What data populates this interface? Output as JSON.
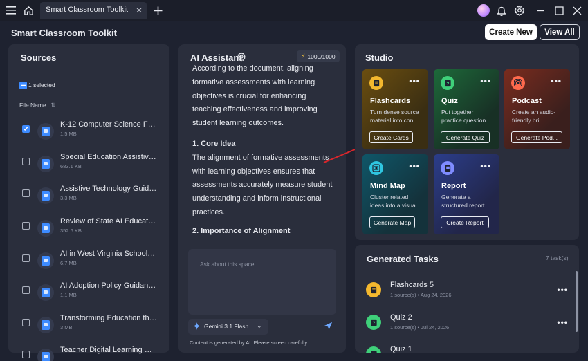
{
  "titlebar": {
    "tab_title": "Smart Classroom Toolkit"
  },
  "header": {
    "title": "Smart Classroom Toolkit",
    "create_new": "Create New",
    "view_all": "View All"
  },
  "sources": {
    "title": "Sources",
    "selected_text": "1 selected",
    "column_label": "File Name",
    "items": [
      {
        "title": "K-12 Computer Science For...",
        "size": "1.5 MB",
        "checked": true
      },
      {
        "title": "Special Education Assistive ...",
        "size": "683.1 KB",
        "checked": false
      },
      {
        "title": "Assistive Technology Guide...",
        "size": "3.3 MB",
        "checked": false
      },
      {
        "title": "Review of State AI Educatio...",
        "size": "352.6 KB",
        "checked": false
      },
      {
        "title": "AI in West Virginia Schools ...",
        "size": "6.7 MB",
        "checked": false
      },
      {
        "title": "AI Adoption Policy Guidanc...",
        "size": "1.1 MB",
        "checked": false
      },
      {
        "title": "Transforming Education thr...",
        "size": "3 MB",
        "checked": false
      },
      {
        "title": "Teacher Digital Learning Gui...",
        "size": "",
        "checked": false
      }
    ]
  },
  "assistant": {
    "title": "AI Assistant",
    "credits": "1000/1000",
    "para1": "According to the document, aligning formative assessments with learning objectives is crucial for enhancing teaching effectiveness and improving student learning outcomes.",
    "heading1": "1. Core Idea",
    "para2": "The alignment of formative assessments with learning objectives ensures that assessments accurately measure student understanding and inform instructional practices.",
    "heading2": "2. Importance of Alignment",
    "input_placeholder": "Ask about this space...",
    "model": "Gemini 3.1 Flash",
    "disclaimer": "Content is generated by AI. Please screen carefully."
  },
  "studio": {
    "title": "Studio",
    "cards": [
      {
        "title": "Flashcards",
        "desc": "Turn dense source material into con...",
        "button": "Create Cards",
        "icon": "flashcard-icon",
        "color": "#f4b82e"
      },
      {
        "title": "Quiz",
        "desc": "Put together practice question...",
        "button": "Generate Quiz",
        "icon": "quiz-icon",
        "color": "#3fd07a"
      },
      {
        "title": "Podcast",
        "desc": "Create an audio-friendly bri...",
        "button": "Generate Pod...",
        "icon": "podcast-icon",
        "color": "#ff6a4d"
      },
      {
        "title": "Mind Map",
        "desc": "Cluster related ideas into a visua...",
        "button": "Generate Map",
        "icon": "mindmap-icon",
        "color": "#2fc6e0"
      },
      {
        "title": "Report",
        "desc": "Generate a structured report ...",
        "button": "Create Report",
        "icon": "report-icon",
        "color": "#7f8cff"
      }
    ]
  },
  "tasks": {
    "title": "Generated Tasks",
    "count": "7 task(s)",
    "items": [
      {
        "title": "Flashcards 5",
        "meta": "1 source(s) • Aug 24, 2026",
        "icon": "flashcard-icon",
        "color": "#f4b82e"
      },
      {
        "title": "Quiz 2",
        "meta": "1 source(s) • Jul 24, 2026",
        "icon": "quiz-icon",
        "color": "#3fd07a"
      },
      {
        "title": "Quiz 1",
        "meta": "",
        "icon": "quiz-icon",
        "color": "#3fd07a"
      }
    ]
  }
}
